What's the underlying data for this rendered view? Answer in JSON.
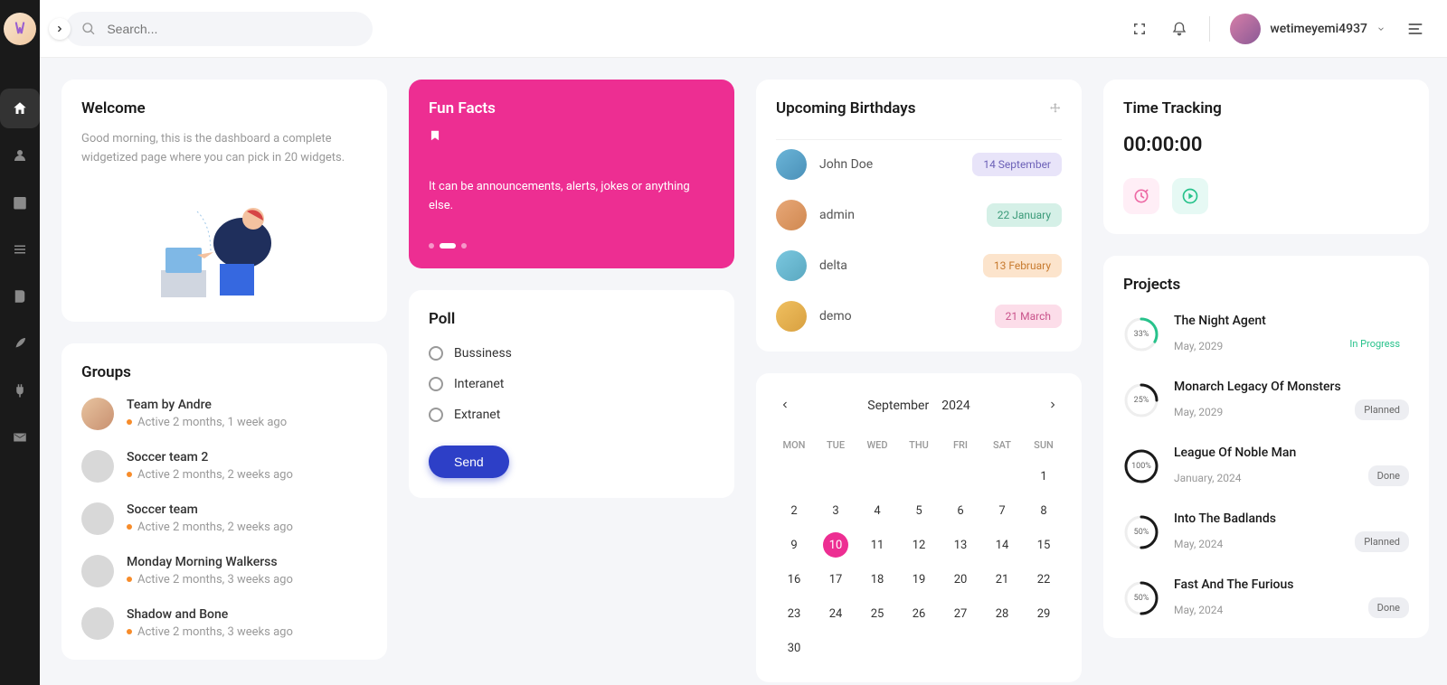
{
  "search": {
    "placeholder": "Search..."
  },
  "user": {
    "name": "wetimeyemi4937"
  },
  "welcome": {
    "title": "Welcome",
    "text": "Good morning, this is the dashboard a complete widgetized page where you can pick in 20 widgets."
  },
  "groups": {
    "title": "Groups",
    "items": [
      {
        "name": "Team by Andre",
        "active": "Active 2 months, 1 week ago"
      },
      {
        "name": "Soccer team 2",
        "active": "Active 2 months, 2 weeks ago"
      },
      {
        "name": "Soccer team",
        "active": "Active 2 months, 2 weeks ago"
      },
      {
        "name": "Monday Morning Walkerss",
        "active": "Active 2 months, 3 weeks ago"
      },
      {
        "name": "Shadow and Bone",
        "active": "Active 2 months, 3 weeks ago"
      }
    ]
  },
  "funfacts": {
    "title": "Fun Facts",
    "text": "It can be announcements, alerts, jokes or anything else."
  },
  "poll": {
    "title": "Poll",
    "options": [
      "Bussiness",
      "Interanet",
      "Extranet"
    ],
    "send": "Send"
  },
  "birthdays": {
    "title": "Upcoming Birthdays",
    "items": [
      {
        "name": "John Doe",
        "date": "14 September",
        "bg": "#e8e4f9",
        "color": "#6d62b8"
      },
      {
        "name": "admin",
        "date": "22 January",
        "bg": "#d5f0e7",
        "color": "#3a9a78"
      },
      {
        "name": "delta",
        "date": "13 February",
        "bg": "#fce4cc",
        "color": "#c77a2e"
      },
      {
        "name": "demo",
        "date": "21 March",
        "bg": "#fcdde9",
        "color": "#c9538b"
      }
    ]
  },
  "calendar": {
    "month": "September",
    "year": "2024",
    "dow": [
      "MON",
      "TUE",
      "WED",
      "THU",
      "FRI",
      "SAT",
      "SUN"
    ],
    "today": 10,
    "startOffset": 6,
    "daysInMonth": 30
  },
  "time": {
    "title": "Time Tracking",
    "value": "00:00:00"
  },
  "projects": {
    "title": "Projects",
    "items": [
      {
        "name": "The Night Agent",
        "date": "May, 2029",
        "status": "In Progress",
        "pct": 33,
        "ring": "#27c28b",
        "status_bg": "transparent",
        "status_color": "#27c28b"
      },
      {
        "name": "Monarch Legacy Of Monsters",
        "date": "May, 2029",
        "status": "Planned",
        "pct": 25,
        "ring": "#1a1a1a",
        "status_bg": "#edeef2",
        "status_color": "#666"
      },
      {
        "name": "League Of Noble Man",
        "date": "January, 2024",
        "status": "Done",
        "pct": 100,
        "ring": "#1a1a1a",
        "status_bg": "#edeef2",
        "status_color": "#666"
      },
      {
        "name": "Into The Badlands",
        "date": "May, 2024",
        "status": "Planned",
        "pct": 50,
        "ring": "#1a1a1a",
        "status_bg": "#edeef2",
        "status_color": "#666"
      },
      {
        "name": "Fast And The Furious",
        "date": "May, 2024",
        "status": "Done",
        "pct": 50,
        "ring": "#1a1a1a",
        "status_bg": "#edeef2",
        "status_color": "#666"
      }
    ]
  }
}
